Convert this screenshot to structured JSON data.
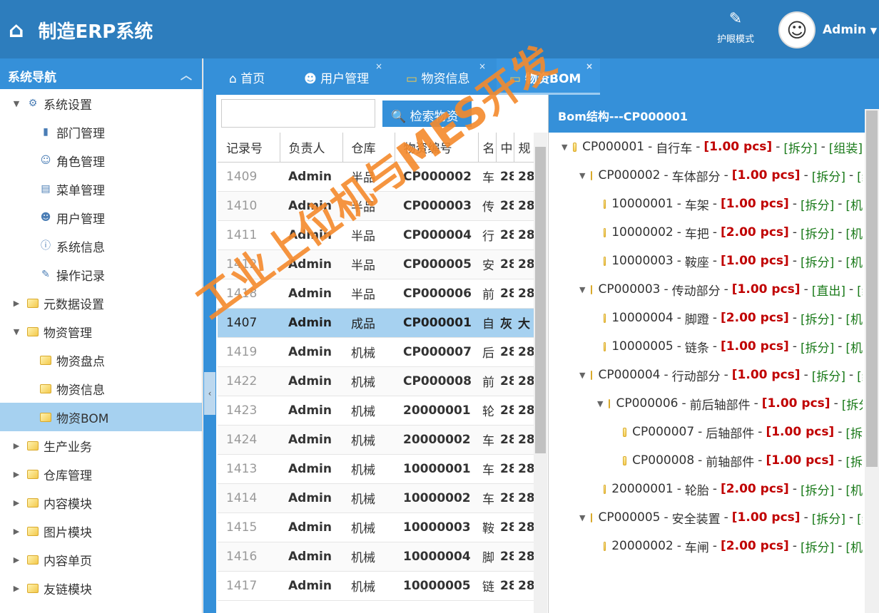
{
  "header": {
    "title": "制造ERP系统",
    "eye_mode": "护眼模式",
    "user": "Admin"
  },
  "sidebar": {
    "title": "系统导航",
    "items": [
      {
        "label": "系统设置",
        "level": 0,
        "expanded": true,
        "icon": "settings-icon"
      },
      {
        "label": "部门管理",
        "level": 1,
        "icon": "door-icon"
      },
      {
        "label": "角色管理",
        "level": 1,
        "icon": "user-role-icon"
      },
      {
        "label": "菜单管理",
        "level": 1,
        "icon": "menu-icon"
      },
      {
        "label": "用户管理",
        "level": 1,
        "icon": "users-icon"
      },
      {
        "label": "系统信息",
        "level": 1,
        "icon": "info-icon"
      },
      {
        "label": "操作记录",
        "level": 1,
        "icon": "log-icon"
      },
      {
        "label": "元数据设置",
        "level": 0,
        "expanded": false,
        "icon": "folder-icon"
      },
      {
        "label": "物资管理",
        "level": 0,
        "expanded": true,
        "icon": "folder-icon"
      },
      {
        "label": "物资盘点",
        "level": 1,
        "icon": "folder-icon"
      },
      {
        "label": "物资信息",
        "level": 1,
        "icon": "folder-icon"
      },
      {
        "label": "物资BOM",
        "level": 1,
        "icon": "folder-icon",
        "active": true
      },
      {
        "label": "生产业务",
        "level": 0,
        "expanded": false,
        "icon": "folder-icon"
      },
      {
        "label": "仓库管理",
        "level": 0,
        "expanded": false,
        "icon": "folder-icon"
      },
      {
        "label": "内容模块",
        "level": 0,
        "expanded": false,
        "icon": "folder-icon"
      },
      {
        "label": "图片模块",
        "level": 0,
        "expanded": false,
        "icon": "folder-icon"
      },
      {
        "label": "内容单页",
        "level": 0,
        "expanded": false,
        "icon": "folder-icon"
      },
      {
        "label": "友链模块",
        "level": 0,
        "expanded": false,
        "icon": "folder-icon"
      }
    ]
  },
  "tabs": [
    {
      "label": "首页",
      "closable": false
    },
    {
      "label": "用户管理",
      "closable": true
    },
    {
      "label": "物资信息",
      "closable": true
    },
    {
      "label": "物资BOM",
      "closable": true,
      "active": true
    }
  ],
  "search": {
    "value": "",
    "button": "检索物资"
  },
  "table": {
    "columns": [
      "记录号",
      "负责人",
      "仓库",
      "物资编号",
      "名",
      "中",
      "规"
    ],
    "rows": [
      [
        "1409",
        "Admin",
        "半品",
        "CP000002",
        "车",
        "28",
        "28"
      ],
      [
        "1410",
        "Admin",
        "半品",
        "CP000003",
        "传",
        "28",
        "28"
      ],
      [
        "1411",
        "Admin",
        "半品",
        "CP000004",
        "行",
        "28",
        "28"
      ],
      [
        "1412",
        "Admin",
        "半品",
        "CP000005",
        "安",
        "28",
        "28"
      ],
      [
        "1418",
        "Admin",
        "半品",
        "CP000006",
        "前",
        "28",
        "28"
      ],
      [
        "1407",
        "Admin",
        "成品",
        "CP000001",
        "自",
        "灰",
        "大"
      ],
      [
        "1419",
        "Admin",
        "机械",
        "CP000007",
        "后",
        "28",
        "28"
      ],
      [
        "1422",
        "Admin",
        "机械",
        "CP000008",
        "前",
        "28",
        "28"
      ],
      [
        "1423",
        "Admin",
        "机械",
        "20000001",
        "轮",
        "28",
        "28"
      ],
      [
        "1424",
        "Admin",
        "机械",
        "20000002",
        "车",
        "28",
        "28"
      ],
      [
        "1413",
        "Admin",
        "机械",
        "10000001",
        "车",
        "28",
        "28"
      ],
      [
        "1414",
        "Admin",
        "机械",
        "10000002",
        "车",
        "28",
        "28"
      ],
      [
        "1415",
        "Admin",
        "机械",
        "10000003",
        "鞍",
        "28",
        "28"
      ],
      [
        "1416",
        "Admin",
        "机械",
        "10000004",
        "脚",
        "28",
        "28"
      ],
      [
        "1417",
        "Admin",
        "机械",
        "10000005",
        "链",
        "28",
        "28"
      ]
    ],
    "selected_row": 5
  },
  "bom": {
    "title": "Bom结构---CP000001",
    "nodes": [
      {
        "code": "CP000001",
        "name": "自行车",
        "qty": "[1.00 pcs]",
        "tag1": "[拆分]",
        "tag2": "[组装]",
        "level": 0,
        "parent": true
      },
      {
        "code": "CP000002",
        "name": "车体部分",
        "qty": "[1.00 pcs]",
        "tag1": "[拆分]",
        "tag2": "[组",
        "level": 1,
        "parent": true
      },
      {
        "code": "10000001",
        "name": "车架",
        "qty": "[1.00 pcs]",
        "tag1": "[拆分]",
        "tag2": "[机",
        "level": 2,
        "parent": false
      },
      {
        "code": "10000002",
        "name": "车把",
        "qty": "[2.00 pcs]",
        "tag1": "[拆分]",
        "tag2": "[机",
        "level": 2,
        "parent": false
      },
      {
        "code": "10000003",
        "name": "鞍座",
        "qty": "[1.00 pcs]",
        "tag1": "[拆分]",
        "tag2": "[机",
        "level": 2,
        "parent": false
      },
      {
        "code": "CP000003",
        "name": "传动部分",
        "qty": "[1.00 pcs]",
        "tag1": "[直出]",
        "tag2": "[组",
        "level": 1,
        "parent": true
      },
      {
        "code": "10000004",
        "name": "脚蹬",
        "qty": "[2.00 pcs]",
        "tag1": "[拆分]",
        "tag2": "[机",
        "level": 2,
        "parent": false
      },
      {
        "code": "10000005",
        "name": "链条",
        "qty": "[1.00 pcs]",
        "tag1": "[拆分]",
        "tag2": "[机",
        "level": 2,
        "parent": false
      },
      {
        "code": "CP000004",
        "name": "行动部分",
        "qty": "[1.00 pcs]",
        "tag1": "[拆分]",
        "tag2": "[组",
        "level": 1,
        "parent": true
      },
      {
        "code": "CP000006",
        "name": "前后轴部件",
        "qty": "[1.00 pcs]",
        "tag1": "[拆分]",
        "tag2": "",
        "level": 2,
        "parent": true
      },
      {
        "code": "CP000007",
        "name": "后轴部件",
        "qty": "[1.00 pcs]",
        "tag1": "[拆",
        "tag2": "",
        "level": 3,
        "parent": false
      },
      {
        "code": "CP000008",
        "name": "前轴部件",
        "qty": "[1.00 pcs]",
        "tag1": "[拆",
        "tag2": "",
        "level": 3,
        "parent": false
      },
      {
        "code": "20000001",
        "name": "轮胎",
        "qty": "[2.00 pcs]",
        "tag1": "[拆分]",
        "tag2": "[机",
        "level": 2,
        "parent": false
      },
      {
        "code": "CP000005",
        "name": "安全装置",
        "qty": "[1.00 pcs]",
        "tag1": "[拆分]",
        "tag2": "[组",
        "level": 1,
        "parent": true
      },
      {
        "code": "20000002",
        "name": "车闸",
        "qty": "[2.00 pcs]",
        "tag1": "[拆分]",
        "tag2": "[机",
        "level": 2,
        "parent": false
      }
    ]
  },
  "watermark": "工业上位机与MES开发",
  "colors": {
    "header": "#2d7dbd",
    "accent": "#3590d9",
    "selected": "#a6d1f0",
    "qty": "#c00000",
    "tag": "#1a7a1a",
    "watermark": "#f58a2c"
  }
}
